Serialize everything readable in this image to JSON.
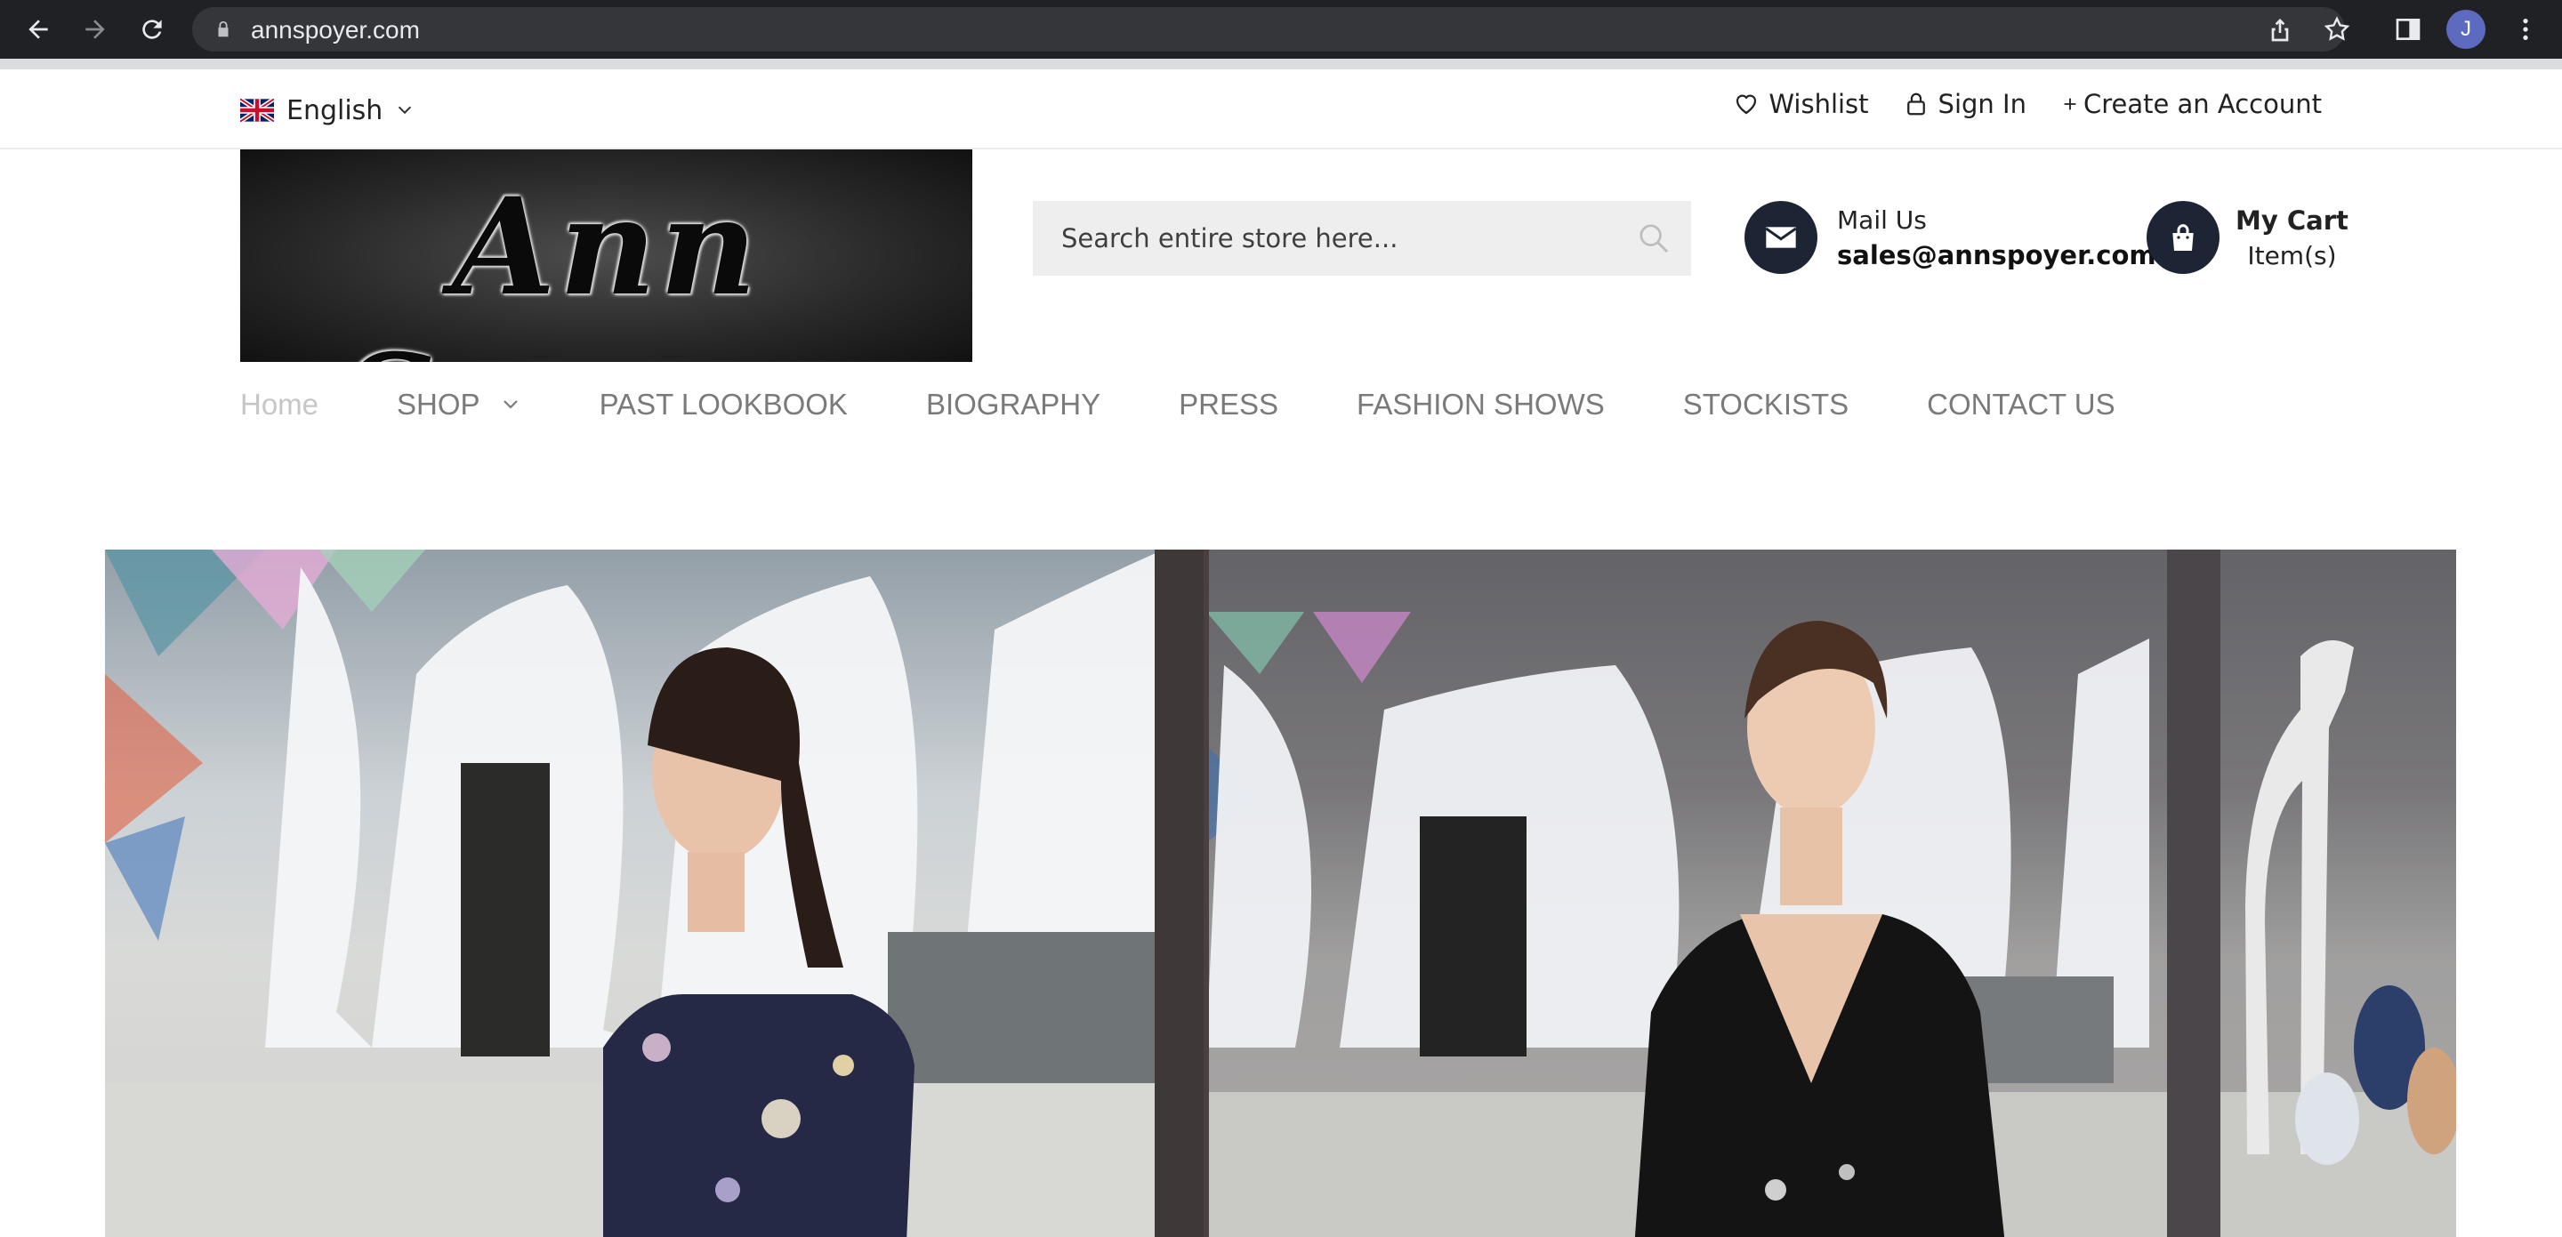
{
  "browser": {
    "url": "annspoyer.com",
    "profile_initial": "J"
  },
  "topbar": {
    "language": "English",
    "wishlist": "Wishlist",
    "sign_in": "Sign In",
    "create_account": "Create an Account"
  },
  "header": {
    "logo_text": "Ann Spoyer",
    "search_placeholder": "Search entire store here...",
    "mail_label": "Mail Us",
    "mail_email": "sales@annspoyer.com",
    "cart_label": "My Cart",
    "cart_items": "Item(s)"
  },
  "nav": {
    "items": [
      {
        "label": "Home"
      },
      {
        "label": "SHOP"
      },
      {
        "label": "PAST LOOKBOOK"
      },
      {
        "label": "BIOGRAPHY"
      },
      {
        "label": "PRESS"
      },
      {
        "label": "FASHION SHOWS"
      },
      {
        "label": "STOCKISTS"
      },
      {
        "label": "CONTACT US"
      }
    ]
  },
  "colors": {
    "chrome_bg": "#202124",
    "nav_text": "#7a7a7a",
    "nav_active": "#c6c6c6",
    "icon_circle": "#1d2433",
    "search_bg": "#eeeeee"
  }
}
